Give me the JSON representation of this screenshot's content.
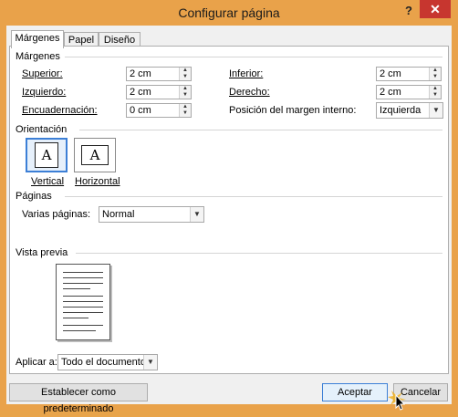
{
  "window": {
    "title": "Configurar página",
    "help_glyph": "?",
    "close_glyph": "✕"
  },
  "tabs": [
    {
      "label": "Márgenes",
      "active": true
    },
    {
      "label": "Papel",
      "active": false
    },
    {
      "label": "Diseño",
      "active": false
    }
  ],
  "margins": {
    "group_label": "Márgenes",
    "superior": {
      "label": "Superior:",
      "value": "2 cm"
    },
    "inferior": {
      "label": "Inferior:",
      "value": "2 cm"
    },
    "izquierdo": {
      "label": "Izquierdo:",
      "value": "2 cm"
    },
    "derecho": {
      "label": "Derecho:",
      "value": "2 cm"
    },
    "encuadernacion": {
      "label": "Encuadernación:",
      "value": "0 cm"
    },
    "posicion": {
      "label": "Posición del margen interno:",
      "value": "Izquierda"
    }
  },
  "orientation": {
    "group_label": "Orientación",
    "glyph": "A",
    "vertical": {
      "label": "Vertical",
      "selected": true
    },
    "horizontal": {
      "label": "Horizontal",
      "selected": false
    }
  },
  "pages": {
    "group_label": "Páginas",
    "multiple_label": "Varias páginas:",
    "multiple_value": "Normal"
  },
  "preview": {
    "group_label": "Vista previa"
  },
  "apply": {
    "label": "Aplicar a:",
    "value": "Todo el documento"
  },
  "buttons": {
    "default": "Establecer como predeterminado",
    "ok": "Aceptar",
    "cancel": "Cancelar"
  },
  "colors": {
    "accent": "#3c7fd6",
    "title_bar": "#e9a24a",
    "close": "#c7362f"
  }
}
